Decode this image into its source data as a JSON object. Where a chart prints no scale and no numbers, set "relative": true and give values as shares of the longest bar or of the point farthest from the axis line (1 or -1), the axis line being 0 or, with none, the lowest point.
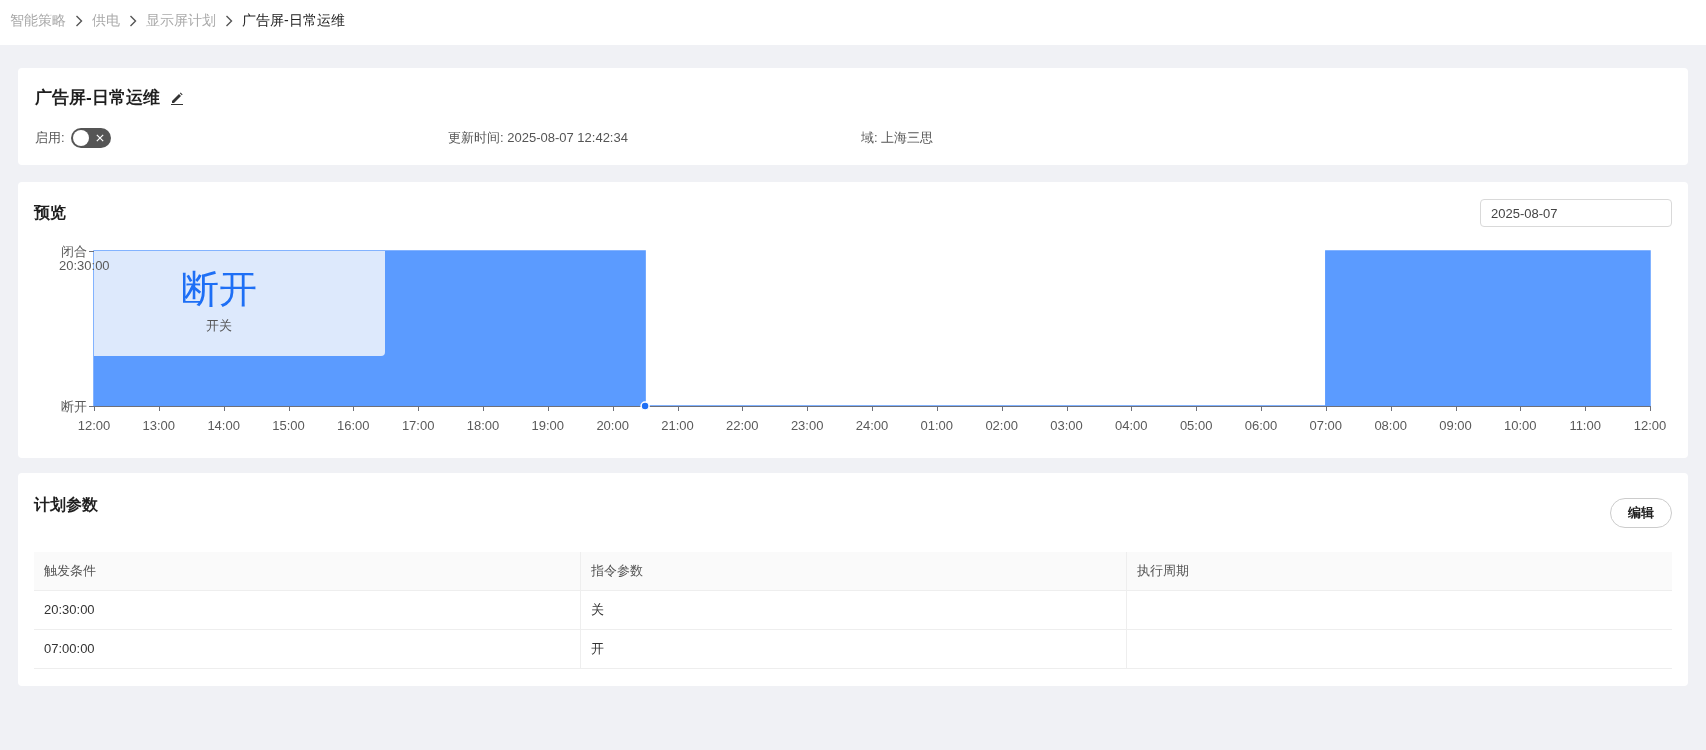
{
  "breadcrumb": [
    {
      "label": "智能策略",
      "current": false
    },
    {
      "label": "供电",
      "current": false
    },
    {
      "label": "显示屏计划",
      "current": false
    },
    {
      "label": "广告屏-日常运维",
      "current": true
    }
  ],
  "plan": {
    "title": "广告屏-日常运维",
    "enabled_label": "启用:",
    "enabled": false,
    "updated": "更新时间: 2025-08-07 12:42:34",
    "domain": "域: 上海三思"
  },
  "preview": {
    "title": "预览",
    "date": "2025-08-07",
    "y_axis_labels": [
      "闭合",
      "断开"
    ],
    "chart_data": {
      "type": "area",
      "relative": true,
      "categories": [
        "12:00",
        null,
        "13:00",
        null,
        "14:00",
        null,
        "15:00",
        null,
        "16:00",
        null,
        "17:00",
        null,
        "18:00",
        null,
        "19:00",
        null,
        "20:00",
        null,
        "21:00",
        null,
        "22:00",
        null,
        "23:00",
        null,
        "24:00",
        null,
        "01:00",
        null,
        "02:00",
        null,
        "03:00",
        null,
        "04:00",
        null,
        "05:00",
        null,
        "06:00",
        null,
        "07:00",
        null,
        "08:00",
        null,
        "09:00",
        null,
        "10:00",
        null,
        "11:00",
        null,
        "12:00"
      ],
      "series": [
        {
          "name": "开关",
          "color": "#5b9bff",
          "values": [
            1,
            1,
            1,
            1,
            1,
            1,
            1,
            1,
            1,
            1,
            1,
            1,
            1,
            1,
            1,
            1,
            1,
            0,
            0,
            0,
            0,
            0,
            0,
            0,
            0,
            0,
            0,
            0,
            0,
            0,
            0,
            0,
            0,
            0,
            0,
            0,
            0,
            0,
            1,
            1,
            1,
            1,
            1,
            1,
            1,
            1,
            1,
            1,
            1
          ]
        }
      ]
    },
    "tooltip": {
      "time": "20:30:00",
      "value": "断开"
    }
  },
  "parameters": {
    "title": "计划参数",
    "edit_button": "编辑",
    "table": {
      "columns": [
        "触发条件",
        "指令参数",
        "执行周期"
      ],
      "rows": [
        [
          "20:30:00",
          "关"
        ],
        [
          "07:00:00",
          "开"
        ]
      ]
    }
  }
}
